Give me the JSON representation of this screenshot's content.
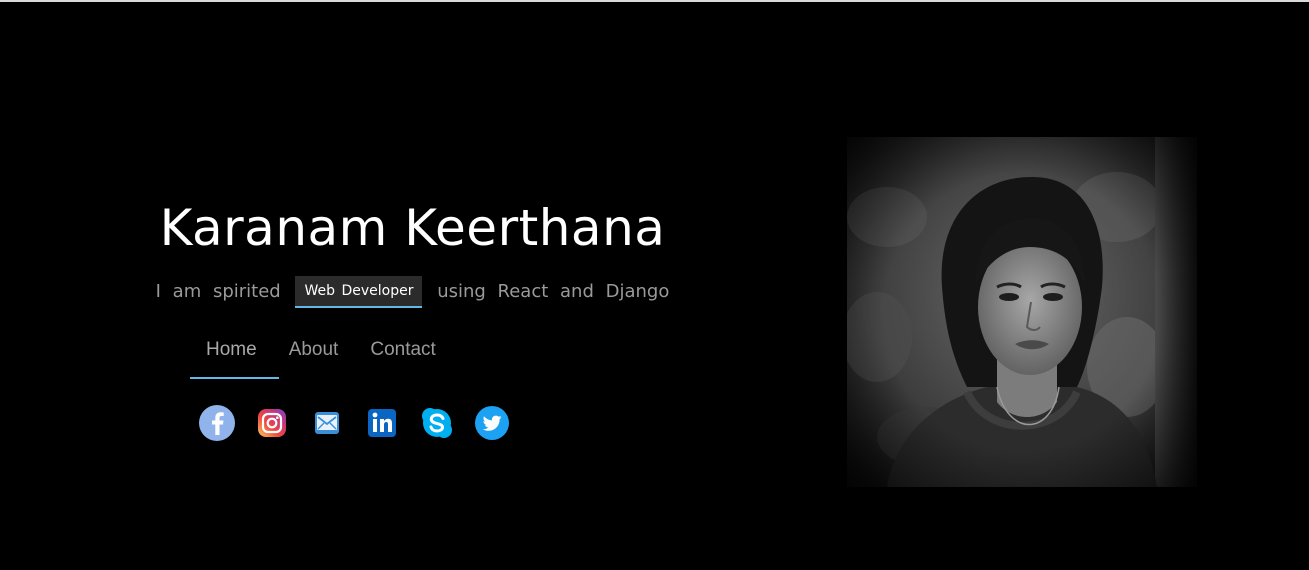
{
  "profile": {
    "name": "Karanam Keerthana",
    "tagline_prefix": "I am spirited",
    "tagline_highlight": "Web Developer",
    "tagline_suffix": "using React and Django"
  },
  "nav": {
    "items": [
      {
        "label": "Home",
        "active": true
      },
      {
        "label": "About",
        "active": false
      },
      {
        "label": "Contact",
        "active": false
      }
    ]
  },
  "socials": [
    {
      "name": "facebook",
      "icon": "facebook-icon",
      "color": "#8fb3ea"
    },
    {
      "name": "instagram",
      "icon": "instagram-icon",
      "color": "#e1306c"
    },
    {
      "name": "email",
      "icon": "email-icon",
      "color": "#3b8fd6"
    },
    {
      "name": "linkedin",
      "icon": "linkedin-icon",
      "color": "#0a66c2"
    },
    {
      "name": "skype",
      "icon": "skype-icon",
      "color": "#00aff0"
    },
    {
      "name": "twitter",
      "icon": "twitter-icon",
      "color": "#1da1f2"
    }
  ],
  "colors": {
    "background": "#000000",
    "accent": "#62b8e6",
    "muted_text": "#9a9a9a",
    "highlight_bg": "#2b2b2b"
  }
}
